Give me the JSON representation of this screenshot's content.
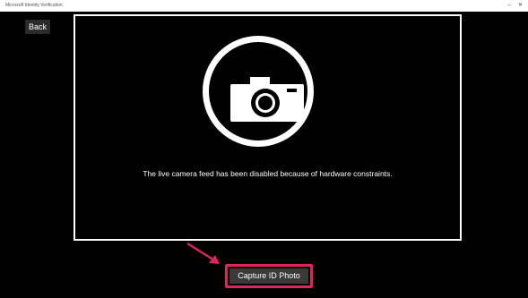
{
  "window": {
    "title": "Microsoft Identity Verification",
    "controls": {
      "minimize_glyph": "–",
      "restore_glyph": "⧉",
      "close_glyph": "✕"
    }
  },
  "navigation": {
    "back_label": "Back"
  },
  "camera": {
    "icon": "camera-icon",
    "status_message": "The live camera feed has been disabled because of hardware constraints."
  },
  "actions": {
    "capture_label": "Capture ID Photo"
  },
  "annotation": {
    "highlight_color": "#e0245e",
    "arrow_color": "#e0245e"
  }
}
